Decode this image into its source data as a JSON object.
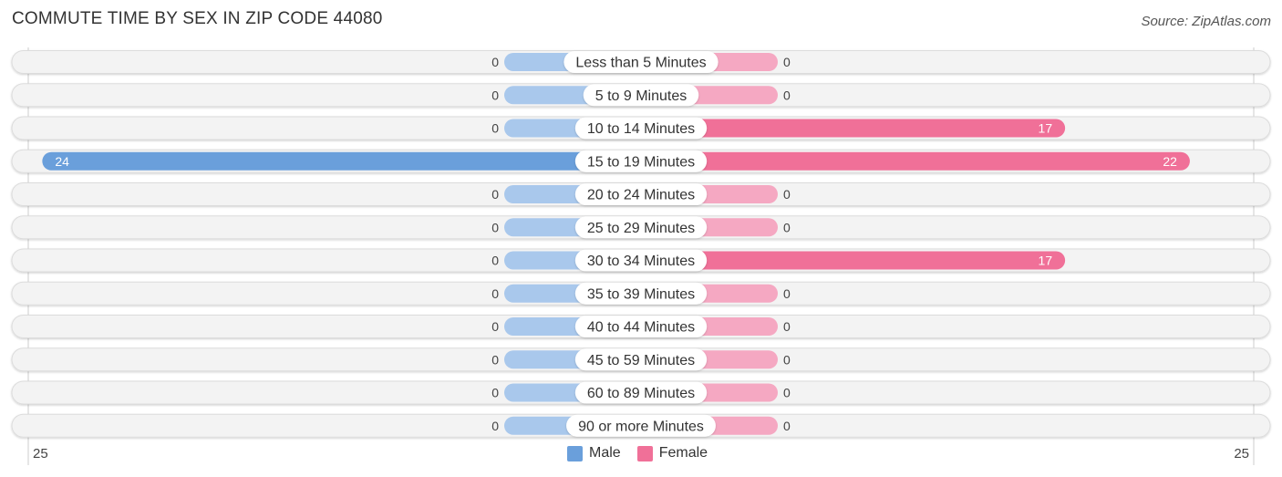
{
  "title": "COMMUTE TIME BY SEX IN ZIP CODE 44080",
  "source": "Source: ZipAtlas.com",
  "colors": {
    "male": "#6a9fdb",
    "male_light": "#a9c8ec",
    "female": "#f07098",
    "female_light": "#f5a8c2",
    "row_bg": "#f3f3f3"
  },
  "legend": [
    {
      "name": "Male",
      "key": "male"
    },
    {
      "name": "Female",
      "key": "female"
    }
  ],
  "axis": {
    "left_label": "25",
    "right_label": "25"
  },
  "chart_data": {
    "type": "bar",
    "orientation": "horizontal-diverging",
    "title": "COMMUTE TIME BY SEX IN ZIP CODE 44080",
    "categories": [
      "Less than 5 Minutes",
      "5 to 9 Minutes",
      "10 to 14 Minutes",
      "15 to 19 Minutes",
      "20 to 24 Minutes",
      "25 to 29 Minutes",
      "30 to 34 Minutes",
      "35 to 39 Minutes",
      "40 to 44 Minutes",
      "45 to 59 Minutes",
      "60 to 89 Minutes",
      "90 or more Minutes"
    ],
    "series": [
      {
        "name": "Male",
        "values": [
          0,
          0,
          0,
          24,
          0,
          0,
          0,
          0,
          0,
          0,
          0,
          0
        ]
      },
      {
        "name": "Female",
        "values": [
          0,
          0,
          17,
          22,
          0,
          0,
          17,
          0,
          0,
          0,
          0,
          0
        ]
      }
    ],
    "xlim": [
      -25,
      25
    ],
    "legend_position": "bottom-center",
    "grid": false
  }
}
